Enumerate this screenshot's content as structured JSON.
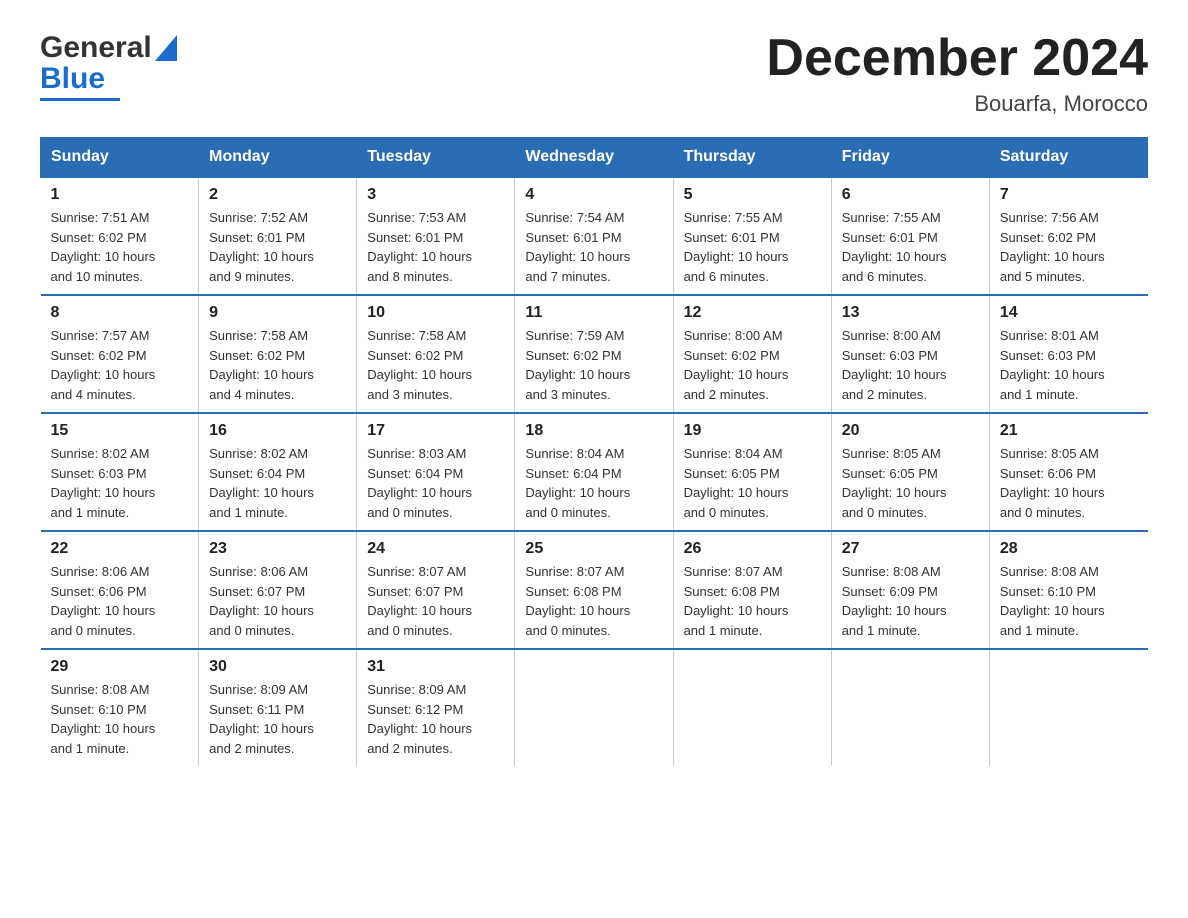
{
  "header": {
    "logo_general": "General",
    "logo_blue": "Blue",
    "title": "December 2024",
    "subtitle": "Bouarfa, Morocco"
  },
  "days_of_week": [
    "Sunday",
    "Monday",
    "Tuesday",
    "Wednesday",
    "Thursday",
    "Friday",
    "Saturday"
  ],
  "weeks": [
    [
      {
        "num": "1",
        "sunrise": "7:51 AM",
        "sunset": "6:02 PM",
        "daylight": "10 hours and 10 minutes."
      },
      {
        "num": "2",
        "sunrise": "7:52 AM",
        "sunset": "6:01 PM",
        "daylight": "10 hours and 9 minutes."
      },
      {
        "num": "3",
        "sunrise": "7:53 AM",
        "sunset": "6:01 PM",
        "daylight": "10 hours and 8 minutes."
      },
      {
        "num": "4",
        "sunrise": "7:54 AM",
        "sunset": "6:01 PM",
        "daylight": "10 hours and 7 minutes."
      },
      {
        "num": "5",
        "sunrise": "7:55 AM",
        "sunset": "6:01 PM",
        "daylight": "10 hours and 6 minutes."
      },
      {
        "num": "6",
        "sunrise": "7:55 AM",
        "sunset": "6:01 PM",
        "daylight": "10 hours and 6 minutes."
      },
      {
        "num": "7",
        "sunrise": "7:56 AM",
        "sunset": "6:02 PM",
        "daylight": "10 hours and 5 minutes."
      }
    ],
    [
      {
        "num": "8",
        "sunrise": "7:57 AM",
        "sunset": "6:02 PM",
        "daylight": "10 hours and 4 minutes."
      },
      {
        "num": "9",
        "sunrise": "7:58 AM",
        "sunset": "6:02 PM",
        "daylight": "10 hours and 4 minutes."
      },
      {
        "num": "10",
        "sunrise": "7:58 AM",
        "sunset": "6:02 PM",
        "daylight": "10 hours and 3 minutes."
      },
      {
        "num": "11",
        "sunrise": "7:59 AM",
        "sunset": "6:02 PM",
        "daylight": "10 hours and 3 minutes."
      },
      {
        "num": "12",
        "sunrise": "8:00 AM",
        "sunset": "6:02 PM",
        "daylight": "10 hours and 2 minutes."
      },
      {
        "num": "13",
        "sunrise": "8:00 AM",
        "sunset": "6:03 PM",
        "daylight": "10 hours and 2 minutes."
      },
      {
        "num": "14",
        "sunrise": "8:01 AM",
        "sunset": "6:03 PM",
        "daylight": "10 hours and 1 minute."
      }
    ],
    [
      {
        "num": "15",
        "sunrise": "8:02 AM",
        "sunset": "6:03 PM",
        "daylight": "10 hours and 1 minute."
      },
      {
        "num": "16",
        "sunrise": "8:02 AM",
        "sunset": "6:04 PM",
        "daylight": "10 hours and 1 minute."
      },
      {
        "num": "17",
        "sunrise": "8:03 AM",
        "sunset": "6:04 PM",
        "daylight": "10 hours and 0 minutes."
      },
      {
        "num": "18",
        "sunrise": "8:04 AM",
        "sunset": "6:04 PM",
        "daylight": "10 hours and 0 minutes."
      },
      {
        "num": "19",
        "sunrise": "8:04 AM",
        "sunset": "6:05 PM",
        "daylight": "10 hours and 0 minutes."
      },
      {
        "num": "20",
        "sunrise": "8:05 AM",
        "sunset": "6:05 PM",
        "daylight": "10 hours and 0 minutes."
      },
      {
        "num": "21",
        "sunrise": "8:05 AM",
        "sunset": "6:06 PM",
        "daylight": "10 hours and 0 minutes."
      }
    ],
    [
      {
        "num": "22",
        "sunrise": "8:06 AM",
        "sunset": "6:06 PM",
        "daylight": "10 hours and 0 minutes."
      },
      {
        "num": "23",
        "sunrise": "8:06 AM",
        "sunset": "6:07 PM",
        "daylight": "10 hours and 0 minutes."
      },
      {
        "num": "24",
        "sunrise": "8:07 AM",
        "sunset": "6:07 PM",
        "daylight": "10 hours and 0 minutes."
      },
      {
        "num": "25",
        "sunrise": "8:07 AM",
        "sunset": "6:08 PM",
        "daylight": "10 hours and 0 minutes."
      },
      {
        "num": "26",
        "sunrise": "8:07 AM",
        "sunset": "6:08 PM",
        "daylight": "10 hours and 1 minute."
      },
      {
        "num": "27",
        "sunrise": "8:08 AM",
        "sunset": "6:09 PM",
        "daylight": "10 hours and 1 minute."
      },
      {
        "num": "28",
        "sunrise": "8:08 AM",
        "sunset": "6:10 PM",
        "daylight": "10 hours and 1 minute."
      }
    ],
    [
      {
        "num": "29",
        "sunrise": "8:08 AM",
        "sunset": "6:10 PM",
        "daylight": "10 hours and 1 minute."
      },
      {
        "num": "30",
        "sunrise": "8:09 AM",
        "sunset": "6:11 PM",
        "daylight": "10 hours and 2 minutes."
      },
      {
        "num": "31",
        "sunrise": "8:09 AM",
        "sunset": "6:12 PM",
        "daylight": "10 hours and 2 minutes."
      },
      null,
      null,
      null,
      null
    ]
  ],
  "labels": {
    "sunrise": "Sunrise:",
    "sunset": "Sunset:",
    "daylight": "Daylight:"
  }
}
